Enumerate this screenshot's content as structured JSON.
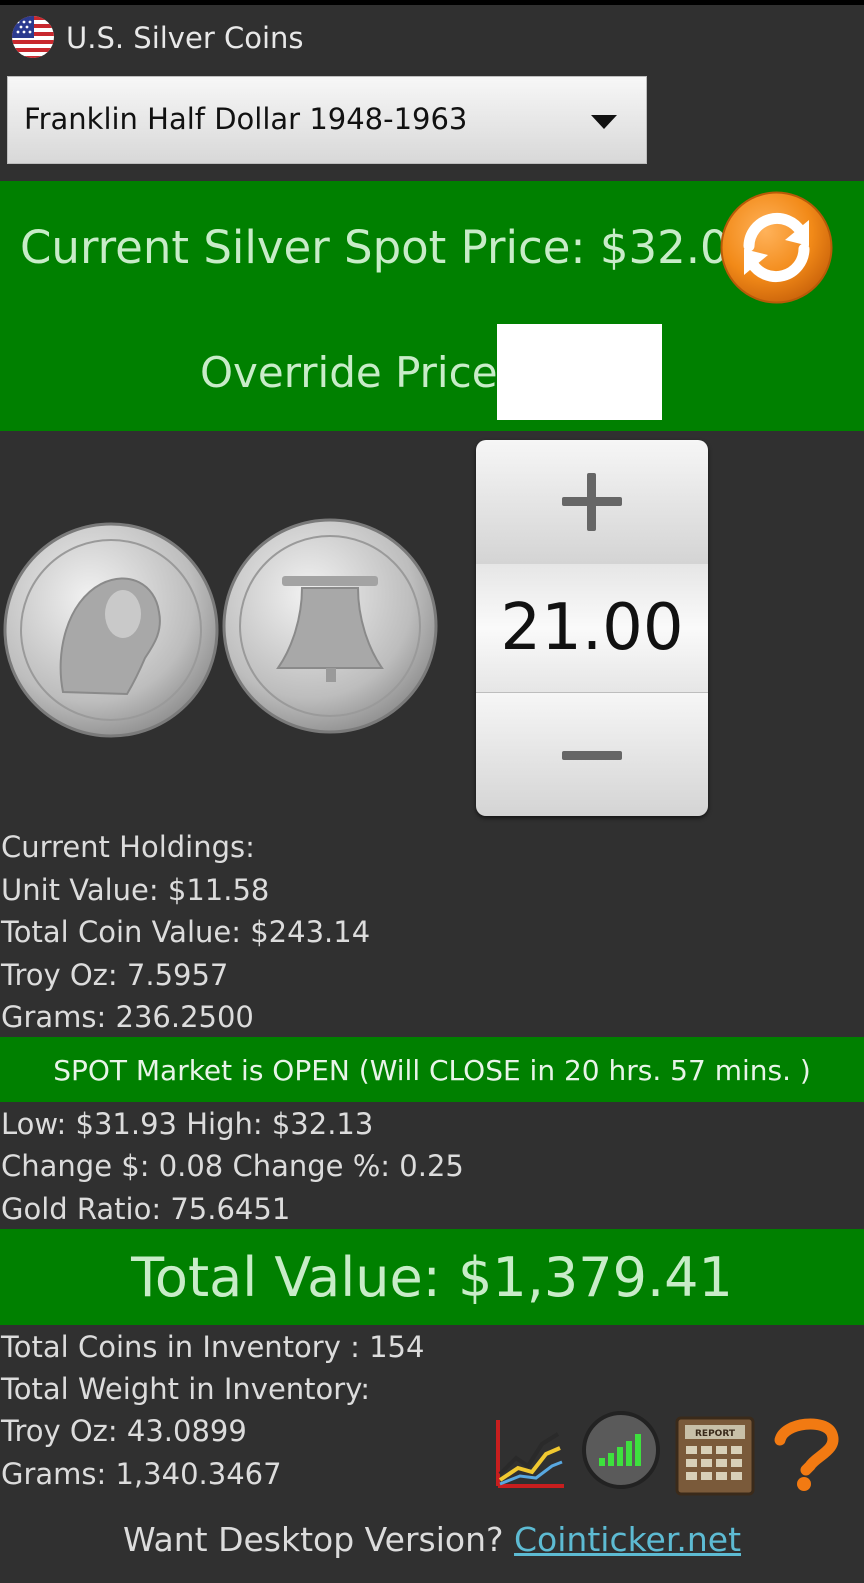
{
  "app": {
    "title": "U.S. Silver Coins"
  },
  "selector": {
    "selected": "Franklin Half Dollar 1948-1963"
  },
  "spot": {
    "label": "Current Silver Spot Price: $32.01"
  },
  "override": {
    "label": "Override Price:",
    "value": "",
    "placeholder": ""
  },
  "stepper": {
    "value": "21.00"
  },
  "holdings": {
    "heading": "Current Holdings:",
    "unit_value": "Unit Value: $11.58",
    "total_coin_value": "Total Coin Value: $243.14",
    "troy_oz": "Troy Oz: 7.5957",
    "grams": "Grams: 236.2500"
  },
  "market": {
    "status": "SPOT Market is OPEN (Will CLOSE in 20 hrs. 57 mins. )",
    "low_high": "Low: $31.93 High: $32.13",
    "change": "Change $: 0.08 Change %: 0.25",
    "gold_ratio": "Gold Ratio: 75.6451"
  },
  "total": {
    "label": "Total Value: $1,379.41"
  },
  "inventory": {
    "coins": "Total Coins in Inventory : 154",
    "weight_heading": "Total Weight in Inventory:",
    "troy_oz": "Troy Oz: 43.0899",
    "grams": "Grams: 1,340.3467"
  },
  "toolbar": {
    "icons": [
      "chart-icon",
      "signal-icon",
      "report-calculator-icon",
      "help-icon"
    ],
    "report_label": "REPORT"
  },
  "footer": {
    "text": "Want Desktop Version? ",
    "link": "Cointicker.net"
  },
  "colors": {
    "band_green": "#008000",
    "background": "#303030",
    "accent_orange": "#f28a18",
    "link": "#5dbbd3"
  }
}
